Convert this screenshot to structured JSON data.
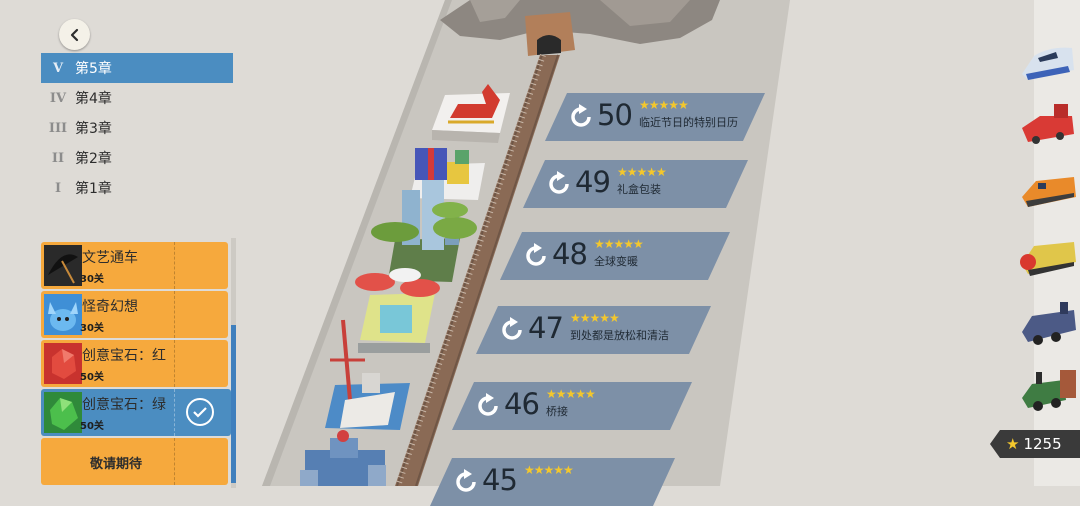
{
  "chapters": [
    {
      "numeral": "V",
      "label": "第5章",
      "active": true
    },
    {
      "numeral": "IV",
      "label": "第4章",
      "active": false
    },
    {
      "numeral": "III",
      "label": "第3章",
      "active": false
    },
    {
      "numeral": "II",
      "label": "第2章",
      "active": false
    },
    {
      "numeral": "I",
      "label": "第1章",
      "active": false
    }
  ],
  "packs": [
    {
      "name": "文艺通车",
      "levels": "30关",
      "icon": "umbrella-pack-icon"
    },
    {
      "name": "怪奇幻想",
      "levels": "30关",
      "icon": "monster-pack-icon"
    },
    {
      "name": "创意宝石：红",
      "levels": "50关",
      "icon": "red-gem-icon"
    },
    {
      "name": "创意宝石：绿",
      "levels": "50关",
      "icon": "green-gem-icon",
      "selected": true
    },
    {
      "name": "敬请期待",
      "coming": true
    }
  ],
  "levels": [
    {
      "number": "50",
      "name": "临近节日的特别日历",
      "stars": "★★★★★"
    },
    {
      "number": "49",
      "name": "礼盒包装",
      "stars": "★★★★★"
    },
    {
      "number": "48",
      "name": "全球变暖",
      "stars": "★★★★★"
    },
    {
      "number": "47",
      "name": "到处都是放松和清洁",
      "stars": "★★★★★"
    },
    {
      "number": "46",
      "name": "桥接",
      "stars": "★★★★★"
    },
    {
      "number": "45",
      "name": "",
      "stars": "★★★★★"
    }
  ],
  "stars_total": "1255",
  "trains": [
    "bullet-train-icon",
    "red-locomotive-icon",
    "orange-diesel-icon",
    "yellow-diesel-icon",
    "blue-steam-icon",
    "green-steam-icon"
  ],
  "colors": {
    "active": "#4b8dc1",
    "pack": "#f6a93d",
    "banner": "#7d90a7",
    "star": "#f3c72d"
  }
}
